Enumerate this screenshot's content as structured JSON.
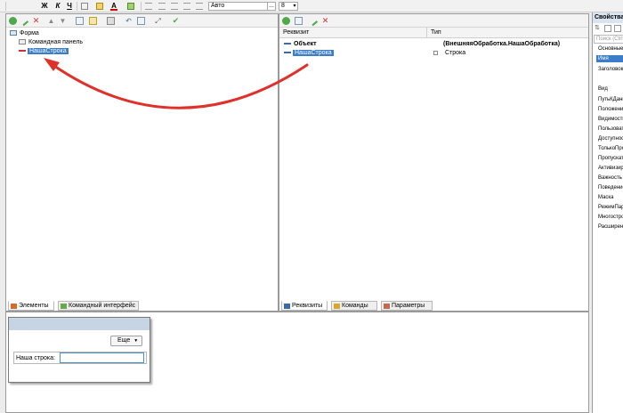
{
  "toolbar": {
    "bold": "Ж",
    "italic": "К",
    "underline": "Ч",
    "font_name": "Авто",
    "font_name_btn": "...",
    "font_size": "8"
  },
  "form_tree": {
    "items": [
      {
        "label": "Форма"
      },
      {
        "label": "Командная панель"
      },
      {
        "label": "НашаСтрока"
      }
    ],
    "tabs": [
      {
        "label": "Элементы"
      },
      {
        "label": "Командный интерфейс"
      }
    ]
  },
  "attributes": {
    "columns": {
      "name": "Реквизит",
      "type": "Тип"
    },
    "rows": [
      {
        "name": "Объект",
        "type": "(ВнешняяОбработка.НашаОбработка)"
      },
      {
        "name": "НашаСтрока",
        "type": "Строка"
      }
    ],
    "tabs": [
      {
        "label": "Реквизиты"
      },
      {
        "label": "Команды"
      },
      {
        "label": "Параметры"
      }
    ]
  },
  "preview": {
    "more_button": "Еще",
    "field_label": "Наша строка:",
    "field_value": ""
  },
  "properties": {
    "title": "Свойства",
    "search_placeholder": "Поиск (Ctrl+F)",
    "group": "Основные",
    "rows": [
      "Имя",
      "Заголовок",
      "Вид",
      "ПутьКДанным",
      "Положение",
      "Видимость",
      "Пользовательская",
      "Доступность",
      "ТолькоПросмотр",
      "ПропускатьПриВводе",
      "АктивизироватьПоУмолч",
      "Важность",
      "ПоведениеПриСжатии",
      "Маска",
      "РежимПароля",
      "Многострочный",
      "РасширенноеРедактирование"
    ]
  },
  "colors": {
    "selection": "#3b7ec7",
    "arrow": "#e0302a",
    "preview_header": "#c6d4e4",
    "field_border": "#4a90d0"
  }
}
